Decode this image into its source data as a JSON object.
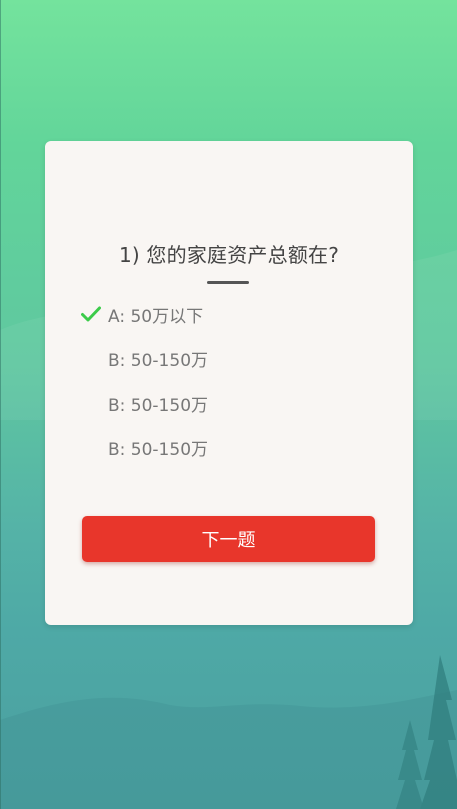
{
  "question": {
    "title": "1) 您的家庭资产总额在?"
  },
  "options": [
    {
      "label": "A: 50万以下",
      "selected": true
    },
    {
      "label": "B: 50-150万",
      "selected": false
    },
    {
      "label": "B: 50-150万",
      "selected": false
    },
    {
      "label": "B: 50-150万",
      "selected": false
    }
  ],
  "next_button": {
    "label": "下一题"
  },
  "colors": {
    "accent": "#e8362b",
    "check": "#3ccb4a",
    "card": "#f9f6f3"
  },
  "icons": {
    "selected": "checkmark-icon"
  }
}
